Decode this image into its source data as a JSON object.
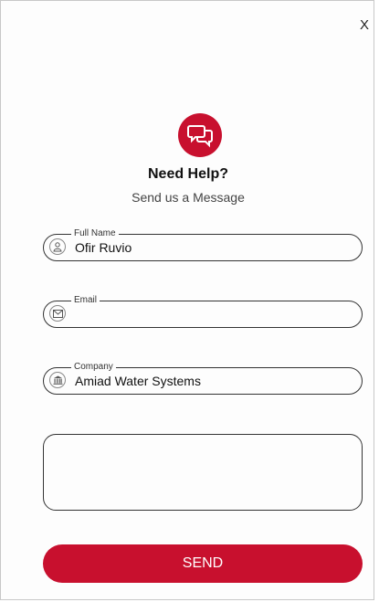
{
  "close": {
    "label": "X"
  },
  "header": {
    "icon": "chat-bubbles-icon",
    "title": "Need Help?",
    "subtitle": "Send us a Message"
  },
  "fields": {
    "full_name": {
      "label": "Full Name",
      "value": "Ofir Ruvio",
      "icon": "person-icon"
    },
    "email": {
      "label": "Email",
      "value": "",
      "icon": "envelope-icon"
    },
    "company": {
      "label": "Company",
      "value": "Amiad Water Systems",
      "icon": "building-icon"
    }
  },
  "message": {
    "value": ""
  },
  "send_button": {
    "label": "SEND"
  },
  "colors": {
    "accent": "#c8102e",
    "border": "#333333"
  }
}
